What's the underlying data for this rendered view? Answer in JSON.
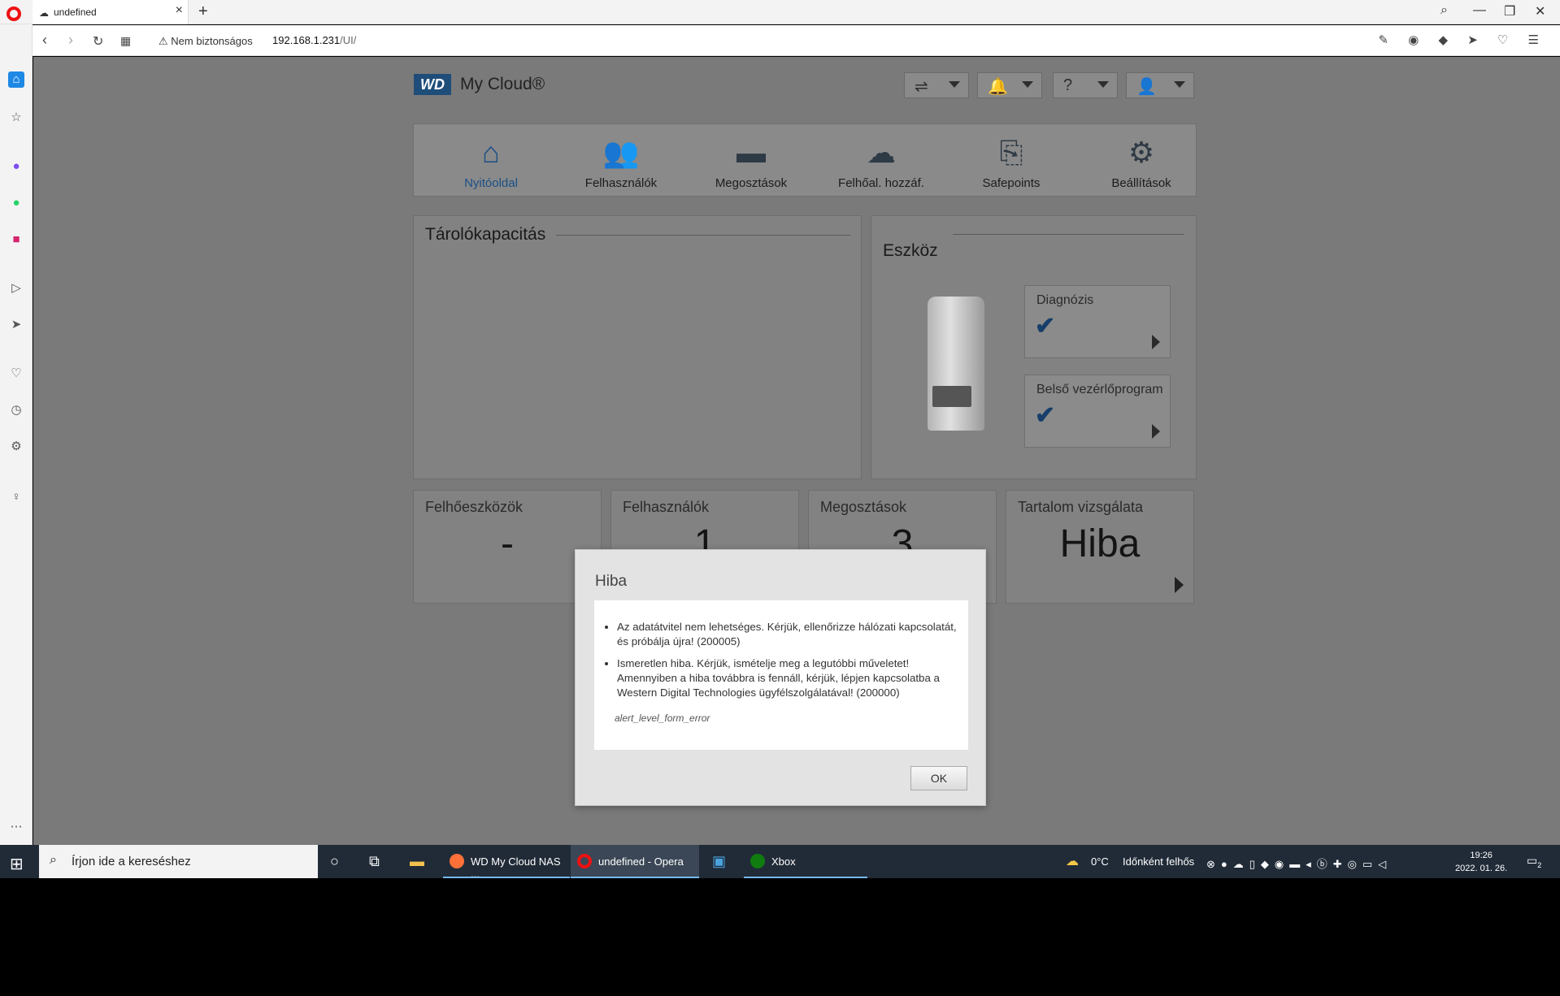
{
  "browser": {
    "tab_title": "undefined",
    "security_label": "Nem biztonságos",
    "url_host": "192.168.1.231",
    "url_path": "/UI/"
  },
  "app": {
    "brand_logo": "WD",
    "brand_name": "My Cloud®"
  },
  "nav": {
    "items": [
      {
        "label": "Nyitóoldal",
        "icon": "home-icon"
      },
      {
        "label": "Felhasználók",
        "icon": "users-icon"
      },
      {
        "label": "Megosztások",
        "icon": "folder-icon"
      },
      {
        "label": "Felhőal. hozzáf.",
        "icon": "cloud-access-icon"
      },
      {
        "label": "Safepoints",
        "icon": "safepoint-icon"
      },
      {
        "label": "Beállítások",
        "icon": "gear-icon"
      }
    ]
  },
  "storage": {
    "title": "Tárolókapacitás"
  },
  "device": {
    "title": "Eszköz",
    "diagnosis_label": "Diagnózis",
    "firmware_label": "Belső vezérlőprogram"
  },
  "stats": [
    {
      "label": "Felhőeszközök",
      "value": "-"
    },
    {
      "label": "Felhasználók",
      "value": "1"
    },
    {
      "label": "Megosztások",
      "value": "3"
    },
    {
      "label": "Tartalom vizsgálata",
      "value": "Hiba"
    }
  ],
  "dialog": {
    "title": "Hiba",
    "messages": [
      "Az adatátvitel nem lehetséges. Kérjük, ellenőrizze hálózati kapcsolatát, és próbálja újra! (200005)",
      "Ismeretlen hiba. Kérjük, ismételje meg a legutóbbi műveletet! Amennyiben a hiba továbbra is fennáll, kérjük, lépjen kapcsolatba a Western Digital Technologies ügyfélszolgálatával! (200000)"
    ],
    "code": "alert_level_form_error",
    "ok_label": "OK"
  },
  "taskbar": {
    "search_placeholder": "Írjon ide a kereséshez",
    "apps": [
      {
        "label": "WD My Cloud NAS ..."
      },
      {
        "label": "undefined - Opera"
      },
      {
        "label": "Xbox"
      }
    ],
    "weather_temp": "0°C",
    "weather_text": "Időnként felhős",
    "time": "19:26",
    "date": "2022. 01. 26.",
    "notification_count": "2"
  }
}
